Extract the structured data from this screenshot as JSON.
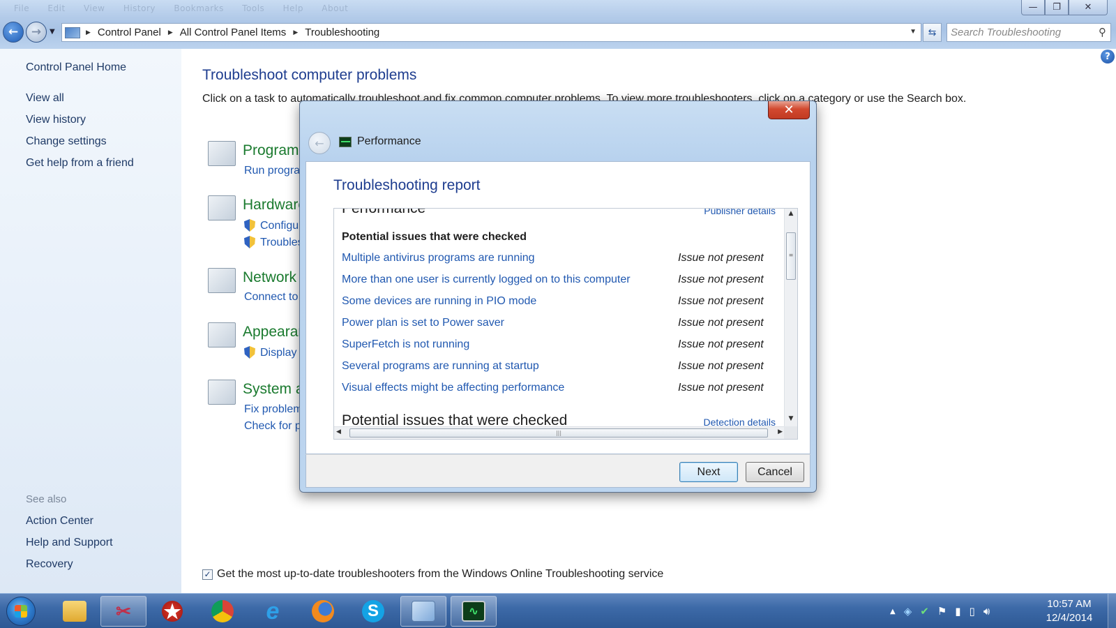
{
  "window": {
    "menu_items": [
      "File",
      "Edit",
      "View",
      "History",
      "Bookmarks",
      "Tools",
      "Help",
      "About"
    ],
    "buttons": {
      "minimize": "—",
      "maximize": "❐",
      "close": "✕"
    }
  },
  "address_bar": {
    "crumbs": [
      "Control Panel",
      "All Control Panel Items",
      "Troubleshooting"
    ],
    "search_placeholder": "Search Troubleshooting"
  },
  "sidebar": {
    "home": "Control Panel Home",
    "links": [
      "View all",
      "View history",
      "Change settings",
      "Get help from a friend"
    ],
    "see_also_label": "See also",
    "see_also": [
      "Action Center",
      "Help and Support",
      "Recovery"
    ]
  },
  "main": {
    "heading": "Troubleshoot computer problems",
    "description": "Click on a task to automatically troubleshoot and fix common computer problems. To view more troubleshooters, click on a category or use the Search box.",
    "categories": [
      {
        "title": "Programs",
        "links": [
          "Run programs made for previous versions of Windows"
        ]
      },
      {
        "title": "Hardware and Sound",
        "links": [
          "Configure a device",
          "Troubleshoot audio playback"
        ]
      },
      {
        "title": "Network and Internet",
        "links": [
          "Connect to the Internet"
        ]
      },
      {
        "title": "Appearance and Personalization",
        "links": [
          "Display Aero desktop effects"
        ]
      },
      {
        "title": "System and Security",
        "links": [
          "Fix problems with Windows Update",
          "Check for performance issues"
        ]
      }
    ],
    "online_checkbox_label": "Get the most up-to-date troubleshooters from the Windows Online Troubleshooting service",
    "online_checked": true
  },
  "dialog": {
    "app_title": "Performance",
    "heading": "Troubleshooting report",
    "top_section_title": "Performance",
    "publisher_link": "Publisher details",
    "issues_header": "Potential issues that were checked",
    "issues": [
      {
        "name": "Multiple antivirus programs are running",
        "status": "Issue not present"
      },
      {
        "name": "More than one user is currently logged on to this computer",
        "status": "Issue not present"
      },
      {
        "name": "Some devices are running in PIO mode",
        "status": "Issue not present"
      },
      {
        "name": "Power plan is set to Power saver",
        "status": "Issue not present"
      },
      {
        "name": "SuperFetch is not running",
        "status": "Issue not present"
      },
      {
        "name": "Several programs are running at startup",
        "status": "Issue not present"
      },
      {
        "name": "Visual effects might be affecting performance",
        "status": "Issue not present"
      }
    ],
    "bottom_section_title": "Potential issues that were checked",
    "detection_link": "Detection details",
    "next_label": "Next",
    "cancel_label": "Cancel"
  },
  "taskbar": {
    "apps": [
      "Windows Explorer",
      "Snipping Tool",
      "PokerStars",
      "Google Chrome",
      "Internet Explorer",
      "Firefox",
      "Skype",
      "Control Panel",
      "Performance Monitor"
    ],
    "clock_time": "10:57 AM",
    "clock_date": "12/4/2014"
  },
  "colors": {
    "heading_blue": "#1e3d8f",
    "link_blue": "#2058b0",
    "category_green": "#1a7a2e",
    "close_red": "#c13a22"
  }
}
